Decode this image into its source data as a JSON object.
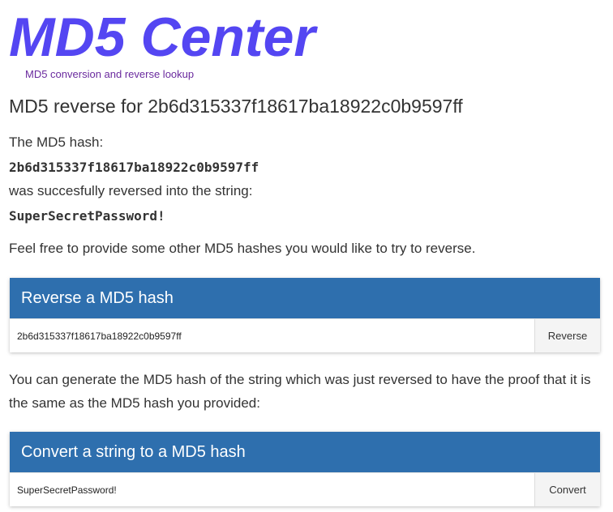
{
  "header": {
    "logo": "MD5 Center",
    "tagline": "MD5 conversion and reverse lookup"
  },
  "main": {
    "title": "MD5 reverse for 2b6d315337f18617ba18922c0b9597ff",
    "hash_intro": "The MD5 hash:",
    "hash_value": "2b6d315337f18617ba18922c0b9597ff",
    "reversed_intro": "was succesfully reversed into the string:",
    "reversed_value": "SuperSecretPassword!",
    "invite_text": "Feel free to provide some other MD5 hashes you would like to try to reverse.",
    "proof_text": "You can generate the MD5 hash of the string which was just reversed to have the proof that it is the same as the MD5 hash you provided:"
  },
  "reverse_panel": {
    "title": "Reverse a MD5 hash",
    "input_value": "2b6d315337f18617ba18922c0b9597ff",
    "button_label": "Reverse"
  },
  "convert_panel": {
    "title": "Convert a string to a MD5 hash",
    "input_value": "SuperSecretPassword!",
    "button_label": "Convert"
  },
  "colors": {
    "logo": "#5446f2",
    "tagline": "#6a2a9e",
    "panel_header": "#2e6fae"
  }
}
